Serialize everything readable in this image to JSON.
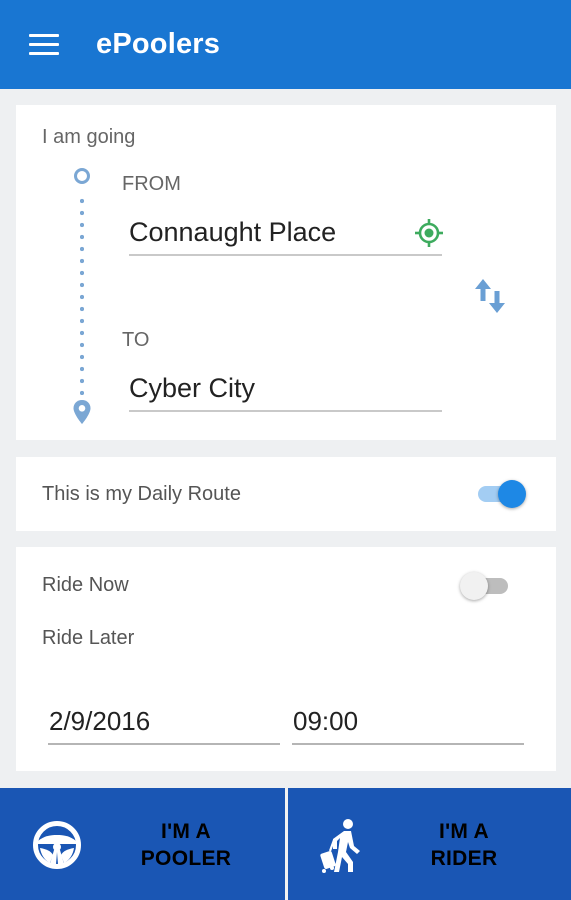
{
  "appbar": {
    "title": "ePoolers",
    "menu_icon": "hamburger-menu-icon",
    "color": "#1976d2"
  },
  "route": {
    "heading": "I am going",
    "from_label": "FROM",
    "from_value": "Connaught Place",
    "to_label": "TO",
    "to_value": "Cyber City",
    "locate_icon": "my-location-icon",
    "swap_icon": "swap-vertical-icon"
  },
  "daily": {
    "label": "This is my Daily Route",
    "enabled": true
  },
  "timing": {
    "ride_now_label": "Ride Now",
    "ride_now_enabled": false,
    "ride_later_label": "Ride Later",
    "date": "2/9/2016",
    "time": "09:00"
  },
  "actions": {
    "pooler_line1": "I'M A",
    "pooler_line2": "POOLER",
    "pooler_icon": "steering-wheel-icon",
    "rider_line1": "I'M A",
    "rider_line2": "RIDER",
    "rider_icon": "walking-with-luggage-icon",
    "color": "#1a56b4"
  },
  "colors": {
    "accent": "#1e88e5",
    "route_line": "#7ba7d4",
    "locate_green": "#3dab5e"
  }
}
